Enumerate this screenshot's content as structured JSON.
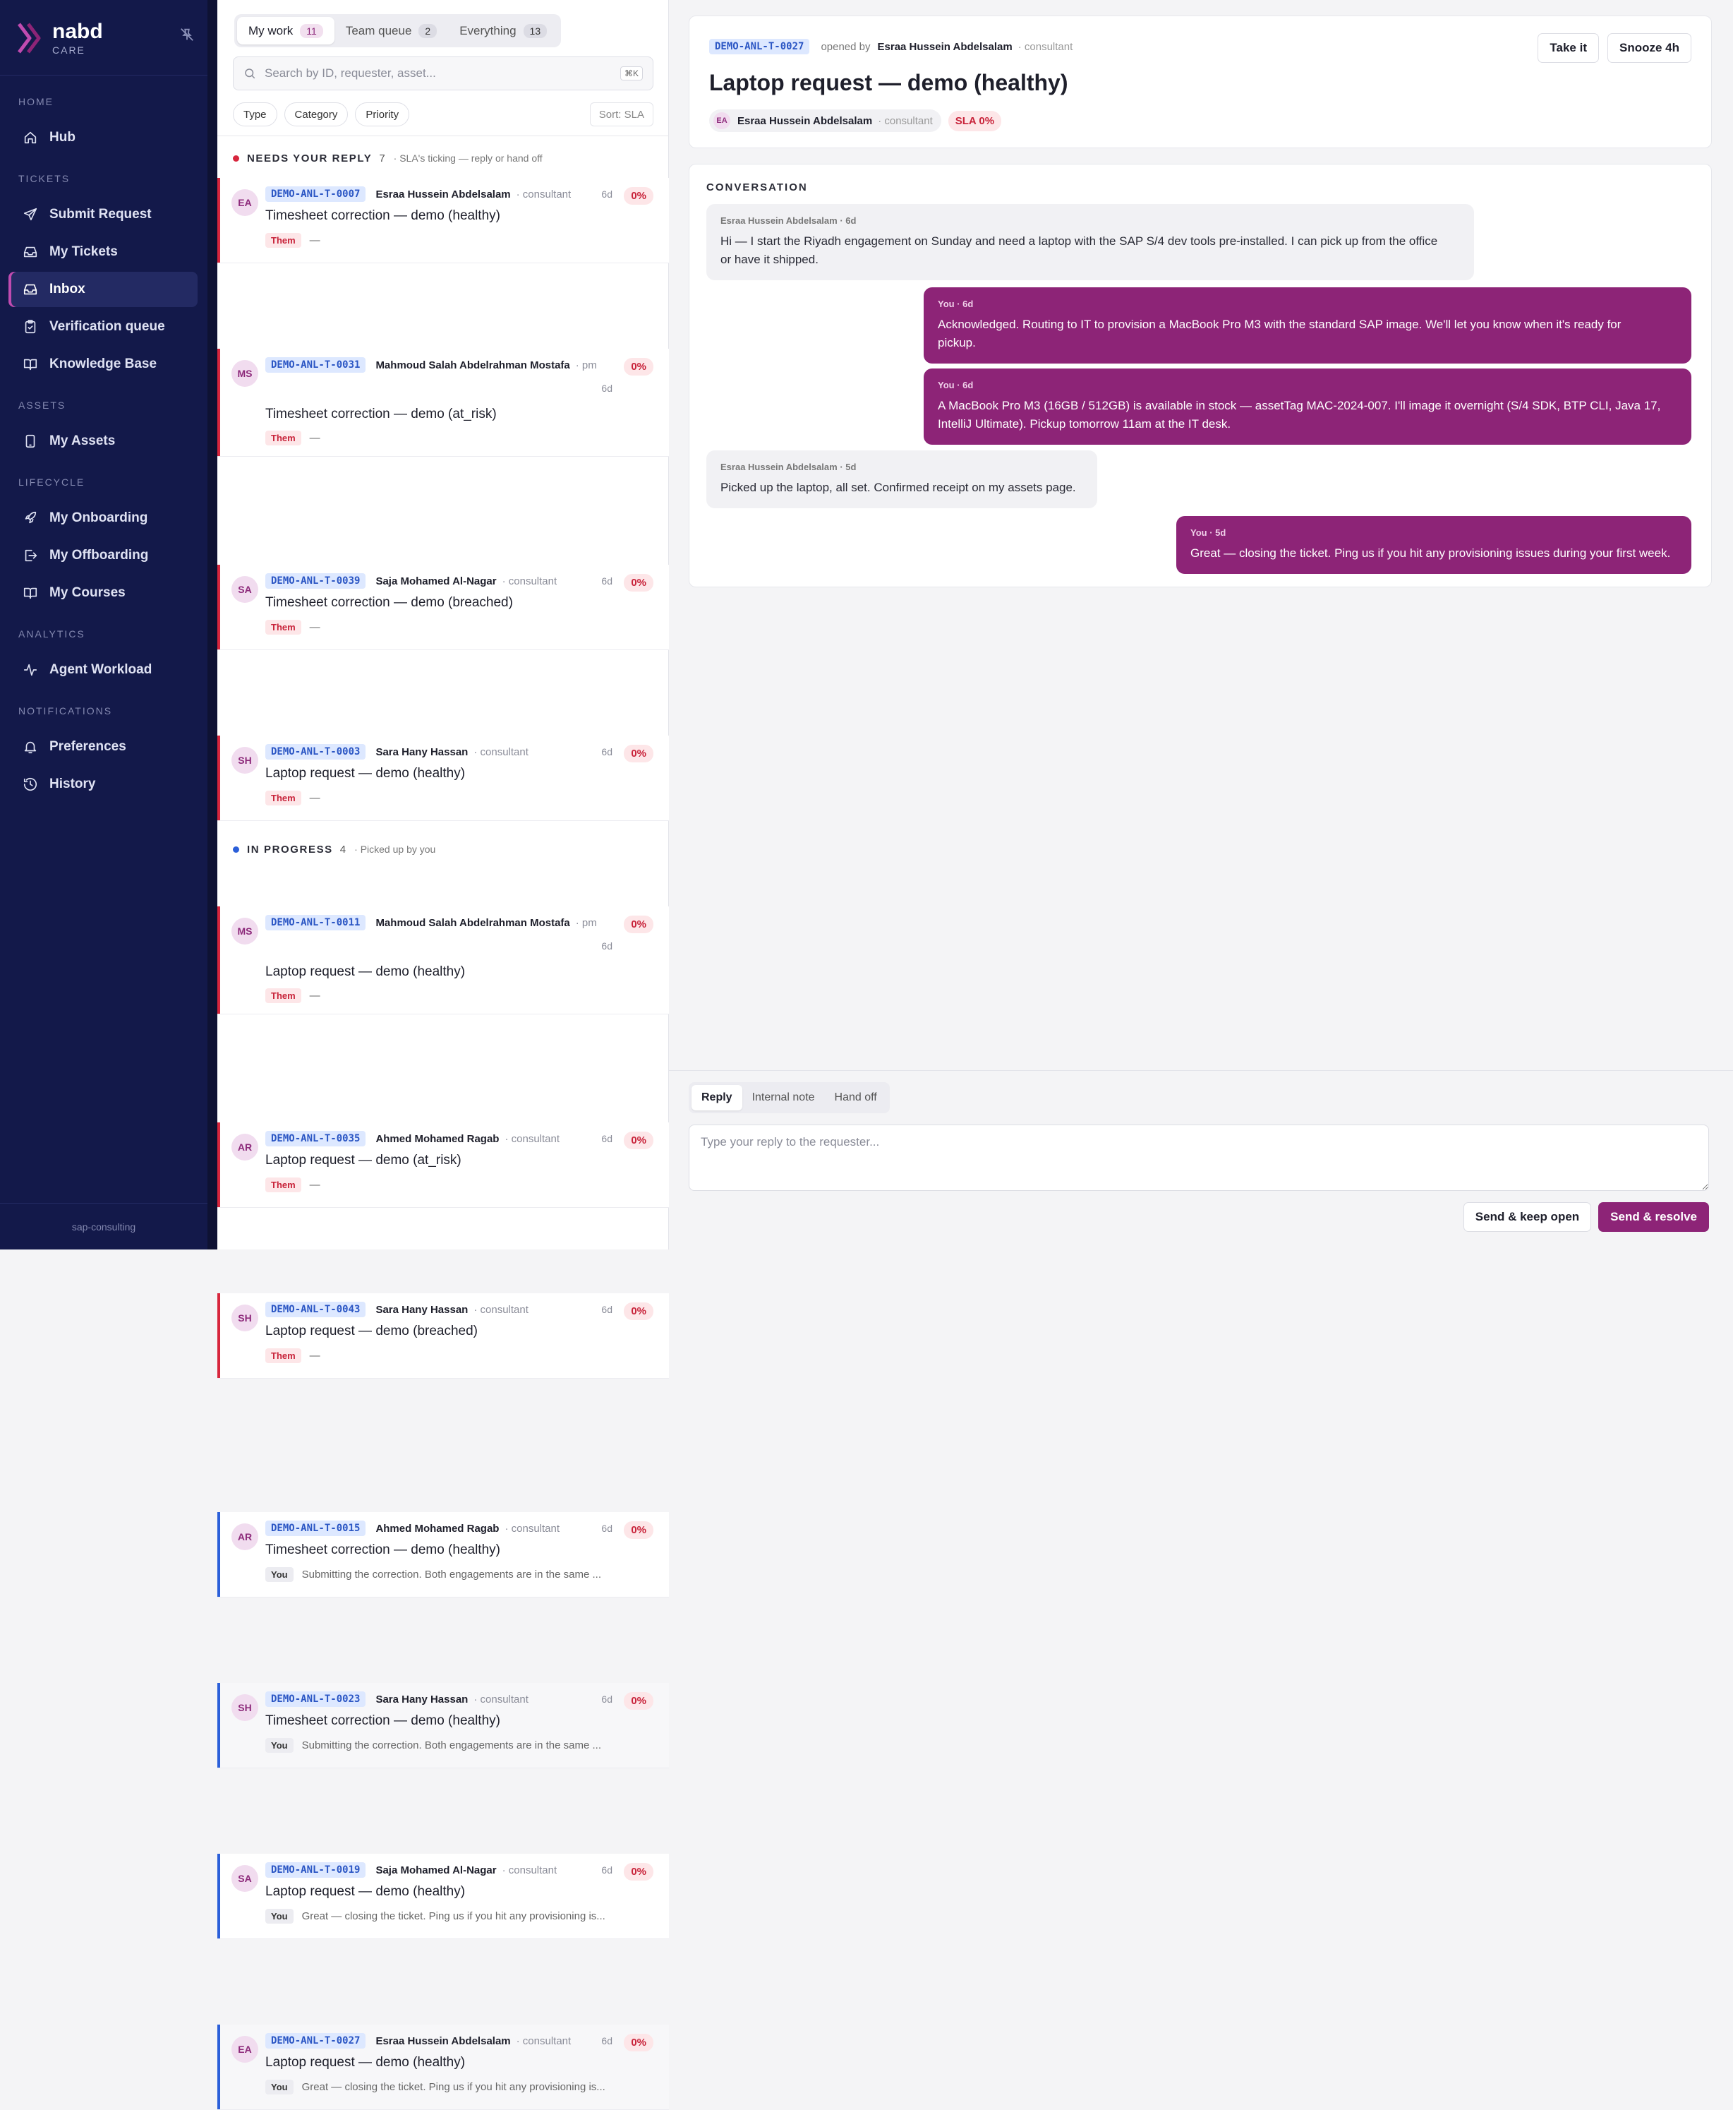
{
  "brand": {
    "name": "nabd",
    "sub": "CARE"
  },
  "nav": [
    {
      "section": "HOME",
      "items": [
        {
          "label": "Hub",
          "icon": "home-icon"
        }
      ]
    },
    {
      "section": "TICKETS",
      "items": [
        {
          "label": "Submit Request",
          "icon": "send-icon"
        },
        {
          "label": "My Tickets",
          "icon": "inbox-icon"
        },
        {
          "label": "Inbox",
          "icon": "inbox-icon",
          "active": true
        },
        {
          "label": "Verification queue",
          "icon": "clipboard-icon"
        },
        {
          "label": "Knowledge Base",
          "icon": "book-icon"
        }
      ]
    },
    {
      "section": "ASSETS",
      "items": [
        {
          "label": "My Assets",
          "icon": "device-icon"
        }
      ]
    },
    {
      "section": "LIFECYCLE",
      "items": [
        {
          "label": "My Onboarding",
          "icon": "rocket-icon"
        },
        {
          "label": "My Offboarding",
          "icon": "logout-icon"
        },
        {
          "label": "My Courses",
          "icon": "book-icon"
        }
      ]
    },
    {
      "section": "ANALYTICS",
      "items": [
        {
          "label": "Agent Workload",
          "icon": "activity-icon"
        }
      ]
    },
    {
      "section": "NOTIFICATIONS",
      "items": [
        {
          "label": "Preferences",
          "icon": "bell-icon"
        },
        {
          "label": "History",
          "icon": "history-icon"
        }
      ]
    }
  ],
  "sidebar_footer": "sap-consulting",
  "list": {
    "tabs": [
      {
        "label": "My work",
        "count": "11"
      },
      {
        "label": "Team queue",
        "count": "2"
      },
      {
        "label": "Everything",
        "count": "13"
      }
    ],
    "search_placeholder": "Search by ID, requester, asset...",
    "search_shortcut": "⌘K",
    "filters": [
      "Type",
      "Category",
      "Priority"
    ],
    "sort": "Sort: SLA",
    "groups": [
      {
        "title": "NEEDS YOUR REPLY",
        "count": "7",
        "subtitle": "· SLA's ticking — reply or hand off",
        "dot_color": "#d7263d",
        "bar_color": "#d7263d",
        "rows": [
          {
            "initials": "EA",
            "id": "DEMO-ANL-T-0007",
            "requester": "Esraa Hussein Abdelsalam",
            "role": "· consultant",
            "age": "6d",
            "sla": "0%",
            "title": "Timesheet correction — demo (healthy)",
            "who": "Them",
            "snippet": "—"
          },
          {
            "initials": "MS",
            "id": "DEMO-ANL-T-0031",
            "requester": "Mahmoud Salah Abdelrahman Mostafa",
            "role": "· pm",
            "age": "6d",
            "sla": "0%",
            "title": "Timesheet correction — demo (at_risk)",
            "who": "Them",
            "snippet": "—",
            "wrap": true
          },
          {
            "initials": "SA",
            "id": "DEMO-ANL-T-0039",
            "requester": "Saja Mohamed Al-Nagar",
            "role": "· consultant",
            "age": "6d",
            "sla": "0%",
            "title": "Timesheet correction — demo (breached)",
            "who": "Them",
            "snippet": "—"
          },
          {
            "initials": "SH",
            "id": "DEMO-ANL-T-0003",
            "requester": "Sara Hany Hassan",
            "role": "· consultant",
            "age": "6d",
            "sla": "0%",
            "title": "Laptop request — demo (healthy)",
            "who": "Them",
            "snippet": "—"
          },
          {
            "initials": "MS",
            "id": "DEMO-ANL-T-0011",
            "requester": "Mahmoud Salah Abdelrahman Mostafa",
            "role": "· pm",
            "age": "6d",
            "sla": "0%",
            "title": "Laptop request — demo (healthy)",
            "who": "Them",
            "snippet": "—",
            "wrap": true
          },
          {
            "initials": "AR",
            "id": "DEMO-ANL-T-0035",
            "requester": "Ahmed Mohamed Ragab",
            "role": "· consultant",
            "age": "6d",
            "sla": "0%",
            "title": "Laptop request — demo (at_risk)",
            "who": "Them",
            "snippet": "—"
          },
          {
            "initials": "SH",
            "id": "DEMO-ANL-T-0043",
            "requester": "Sara Hany Hassan",
            "role": "· consultant",
            "age": "6d",
            "sla": "0%",
            "title": "Laptop request — demo (breached)",
            "who": "Them",
            "snippet": "—"
          }
        ]
      },
      {
        "title": "IN PROGRESS",
        "count": "4",
        "subtitle": "· Picked up by you",
        "dot_color": "#2b5fd9",
        "bar_color": "#2b5fd9",
        "rows": [
          {
            "initials": "AR",
            "id": "DEMO-ANL-T-0015",
            "requester": "Ahmed Mohamed Ragab",
            "role": "· consultant",
            "age": "6d",
            "sla": "0%",
            "title": "Timesheet correction — demo (healthy)",
            "who": "You",
            "snippet": "Submitting the correction. Both engagements are in the same ..."
          },
          {
            "initials": "SH",
            "id": "DEMO-ANL-T-0023",
            "requester": "Sara Hany Hassan",
            "role": "· consultant",
            "age": "6d",
            "sla": "0%",
            "title": "Timesheet correction — demo (healthy)",
            "who": "You",
            "snippet": "Submitting the correction. Both engagements are in the same ...",
            "alt": true
          },
          {
            "initials": "SA",
            "id": "DEMO-ANL-T-0019",
            "requester": "Saja Mohamed Al-Nagar",
            "role": "· consultant",
            "age": "6d",
            "sla": "0%",
            "title": "Laptop request — demo (healthy)",
            "who": "You",
            "snippet": "Great — closing the ticket. Ping us if you hit any provisioning is..."
          },
          {
            "initials": "EA",
            "id": "DEMO-ANL-T-0027",
            "requester": "Esraa Hussein Abdelsalam",
            "role": "· consultant",
            "age": "6d",
            "sla": "0%",
            "title": "Laptop request — demo (healthy)",
            "who": "You",
            "snippet": "Great — closing the ticket. Ping us if you hit any provisioning is...",
            "alt": true
          }
        ]
      }
    ]
  },
  "detail": {
    "id": "DEMO-ANL-T-0027",
    "opened_by_label": "opened by",
    "requester": "Esraa Hussein Abdelsalam",
    "role": "· consultant",
    "title": "Laptop request — demo (healthy)",
    "initials": "EA",
    "sla": "SLA 0%",
    "take_label": "Take it",
    "snooze_label": "Snooze 4h",
    "conversation_label": "CONVERSATION",
    "messages": [
      {
        "from": "them",
        "meta": "Esraa Hussein Abdelsalam · 6d",
        "lines": [
          "Hi — I start the Riyadh engagement on Sunday and need a laptop with the SAP S/4 dev tools pre-installed. I can pick up from the office",
          "or have it shipped."
        ]
      },
      {
        "from": "me",
        "meta": "You · 6d",
        "lines": [
          "Acknowledged. Routing to IT to provision a MacBook Pro M3 with the standard SAP image. We'll let you know when it's ready for",
          "pickup."
        ]
      },
      {
        "from": "me",
        "meta": "You · 6d",
        "lines": [
          "A MacBook Pro M3 (16GB / 512GB) is available in stock — assetTag MAC-2024-007. I'll image it overnight (S/4 SDK, BTP CLI, Java 17,",
          "IntelliJ Ultimate). Pickup tomorrow 11am at the IT desk."
        ]
      },
      {
        "from": "them",
        "meta": "Esraa Hussein Abdelsalam · 5d",
        "lines": [
          "Picked up the laptop, all set. Confirmed receipt on my assets page."
        ]
      },
      {
        "from": "me",
        "meta": "You · 5d",
        "lines": [
          "Great — closing the ticket. Ping us if you hit any provisioning issues during your first week."
        ]
      }
    ]
  },
  "composer": {
    "tabs": [
      "Reply",
      "Internal note",
      "Hand off"
    ],
    "placeholder": "Type your reply to the requester...",
    "keep_open_label": "Send & keep open",
    "resolve_label": "Send & resolve"
  }
}
